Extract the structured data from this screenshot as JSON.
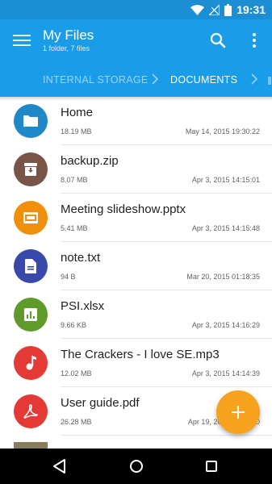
{
  "status_bar": {
    "time": "19:31"
  },
  "app_bar": {
    "title": "My Files",
    "subtitle": "1 folder, 7 files"
  },
  "breadcrumb": {
    "items": [
      "INTERNAL STORAGE",
      "DOCUMENTS"
    ]
  },
  "files": [
    {
      "name": "Home",
      "size": "18.19 MB",
      "date": "May 14, 2015 19:30:22",
      "icon": "folder-icon",
      "color": "#1e88c8"
    },
    {
      "name": "backup.zip",
      "size": "8.07 MB",
      "date": "Apr 3, 2015 14:15:01",
      "icon": "archive-icon",
      "color": "#795548"
    },
    {
      "name": "Meeting slideshow.pptx",
      "size": "5.41 MB",
      "date": "Apr 3, 2015 14:15:48",
      "icon": "slideshow-icon",
      "color": "#ef8f0b"
    },
    {
      "name": "note.txt",
      "size": "94 B",
      "date": "Mar 20, 2015 01:18:35",
      "icon": "document-icon",
      "color": "#3949ab"
    },
    {
      "name": "PSI.xlsx",
      "size": "9.66 KB",
      "date": "Apr 3, 2015 14:16:29",
      "icon": "spreadsheet-icon",
      "color": "#5e9b2a"
    },
    {
      "name": "The Crackers - I love SE.mp3",
      "size": "12.02 MB",
      "date": "Apr 3, 2015 14:14:39",
      "icon": "music-icon",
      "color": "#e53935"
    },
    {
      "name": "User guide.pdf",
      "size": "26.28 MB",
      "date": "Apr 19, 2015 19:50:50",
      "icon": "pdf-icon",
      "color": "#e53935"
    }
  ],
  "colors": {
    "primary": "#1a9de8",
    "status_bar": "#1c8fd4",
    "fab": "#f6a21e"
  }
}
